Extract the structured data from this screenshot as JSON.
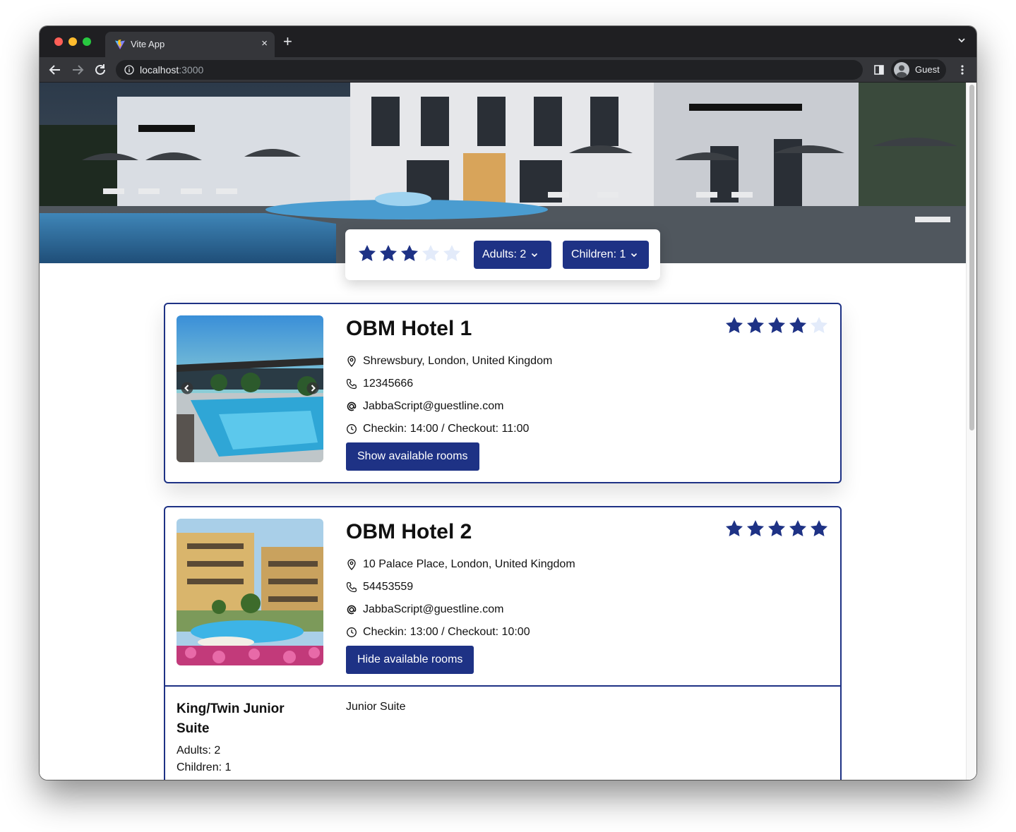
{
  "browser": {
    "tab_title": "Vite App",
    "tab_close": "×",
    "new_tab": "+",
    "url_host": "localhost",
    "url_port": ":3000",
    "profile_label": "Guest"
  },
  "filters": {
    "star_rating": 3,
    "star_max": 5,
    "adults_label": "Adults: 2",
    "children_label": "Children: 1"
  },
  "hotels": [
    {
      "name": "OBM Hotel 1",
      "rating": 4,
      "address": "Shrewsbury, London, United Kingdom",
      "phone": "12345666",
      "email": "JabbaScript@guestline.com",
      "times": "Checkin: 14:00 / Checkout: 11:00",
      "button": "Show available rooms"
    },
    {
      "name": "OBM Hotel 2",
      "rating": 5,
      "address": "10 Palace Place, London, United Kingdom",
      "phone": "54453559",
      "email": "JabbaScript@guestline.com",
      "times": "Checkin: 13:00 / Checkout: 10:00",
      "button": "Hide available rooms",
      "rooms": [
        {
          "name": "King/Twin Junior Suite",
          "adults": "Adults: 2",
          "children": "Children: 1",
          "description": "Junior Suite"
        }
      ]
    }
  ],
  "colors": {
    "brand": "#1e3285",
    "star_filled": "#1e3285",
    "star_empty": "#e3ebfa"
  },
  "icons": [
    "vite-icon",
    "back-icon",
    "forward-icon",
    "reload-icon",
    "info-icon",
    "side-panel-icon",
    "avatar-icon",
    "menu-icon",
    "star-icon",
    "chevron-down-icon",
    "location-icon",
    "phone-icon",
    "at-icon",
    "clock-icon",
    "chevron-left-icon",
    "chevron-right-icon"
  ]
}
